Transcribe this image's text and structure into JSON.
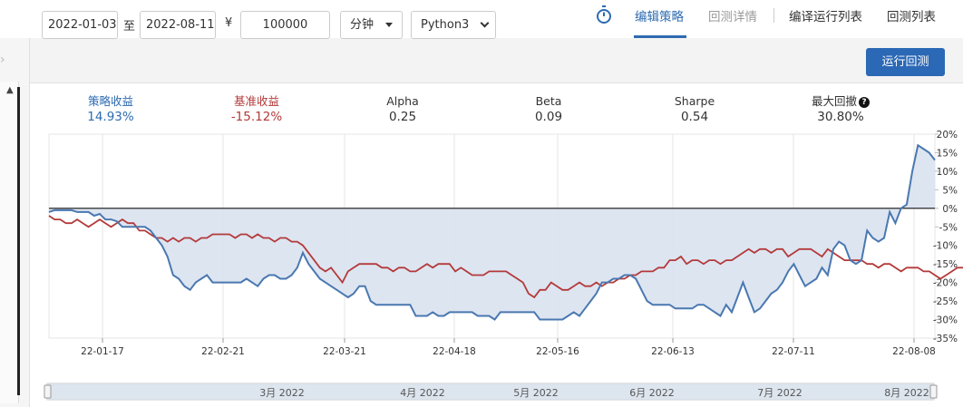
{
  "nav": {
    "items": [
      {
        "label": "编辑策略",
        "active": true
      },
      {
        "label": "回测详情",
        "active": false
      },
      {
        "label": "编译运行列表",
        "active": false
      },
      {
        "label": "回测列表",
        "active": false
      }
    ],
    "timer_icon": "stopwatch-icon"
  },
  "toolbar": {
    "start_date": "2022-01-03",
    "to_label": "至",
    "end_date": "2022-08-11",
    "currency": "¥",
    "capital": "100000",
    "frequency": "分钟",
    "language": "Python3",
    "run_label": "运行回测"
  },
  "metrics": [
    {
      "label": "策略收益",
      "value": "14.93%"
    },
    {
      "label": "基准收益",
      "value": "-15.12%"
    },
    {
      "label": "Alpha",
      "value": "0.25"
    },
    {
      "label": "Beta",
      "value": "0.09"
    },
    {
      "label": "Sharpe",
      "value": "0.54"
    },
    {
      "label": "最大回撤",
      "value": "30.80%"
    }
  ],
  "colors": {
    "accent": "#2e6bb0",
    "strategy": "#4a78b0",
    "benchmark": "#b33a3a",
    "area": "#d9e2ef"
  },
  "chart_data": {
    "type": "line",
    "x_tick_labels": [
      "22-01-17",
      "22-02-21",
      "22-03-21",
      "22-04-18",
      "22-05-16",
      "22-06-13",
      "22-07-11",
      "22-08-08"
    ],
    "y_tick_labels": [
      "20%",
      "15%",
      "10%",
      "5%",
      "0%",
      "-5%",
      "-10%",
      "-15%",
      "-20%",
      "-25%",
      "-30%",
      "-35%"
    ],
    "ylim": [
      -35,
      20
    ],
    "navigator_labels": [
      "3月 2022",
      "4月 2022",
      "5月 2022",
      "6月 2022",
      "7月 2022",
      "8月 2022"
    ],
    "series": [
      {
        "name": "策略收益",
        "values": [
          -1,
          -0.5,
          -0.5,
          -0.5,
          -0.5,
          -1,
          -1,
          -1,
          -2,
          -1.5,
          -3,
          -3,
          -3.5,
          -5,
          -5,
          -5,
          -5,
          -5,
          -6,
          -8,
          -10,
          -13,
          -18,
          -19,
          -21,
          -22,
          -20,
          -19,
          -18,
          -20,
          -20,
          -20,
          -20,
          -20,
          -20,
          -19,
          -20,
          -21,
          -19,
          -18,
          -18,
          -19,
          -19,
          -18,
          -16,
          -12,
          -15,
          -17,
          -19,
          -20,
          -21,
          -22,
          -23,
          -24,
          -23,
          -21,
          -21,
          -25,
          -26,
          -26,
          -26,
          -26,
          -26,
          -26,
          -26,
          -29,
          -29,
          -29,
          -28,
          -29,
          -29,
          -28,
          -28,
          -28,
          -28,
          -28,
          -29,
          -29,
          -29,
          -30,
          -28,
          -28,
          -28,
          -28,
          -28,
          -28,
          -28,
          -30,
          -30,
          -30,
          -30,
          -30,
          -29,
          -28,
          -29,
          -27,
          -25,
          -23,
          -20,
          -20,
          -19,
          -19,
          -18,
          -18,
          -19,
          -22,
          -25,
          -26,
          -26,
          -26,
          -26,
          -27,
          -27,
          -27,
          -27,
          -26,
          -26,
          -27,
          -28,
          -29,
          -26,
          -28,
          -24,
          -20,
          -24,
          -28,
          -27,
          -25,
          -23,
          -22,
          -20,
          -17,
          -15,
          -18,
          -21,
          -20,
          -19,
          -16,
          -18,
          -11,
          -9,
          -10,
          -14,
          -15,
          -14,
          -6,
          -8,
          -9,
          -8,
          -1,
          -4,
          0,
          1,
          10,
          17,
          16,
          15,
          13
        ]
      },
      {
        "name": "基准收益",
        "values": [
          -2,
          -3,
          -3,
          -4,
          -4,
          -3,
          -4,
          -5,
          -4,
          -3,
          -4,
          -5,
          -4,
          -3,
          -4,
          -4,
          -6,
          -6,
          -7,
          -8,
          -8,
          -9,
          -8,
          -9,
          -8,
          -8,
          -9,
          -8,
          -8,
          -7,
          -7,
          -7,
          -7,
          -8,
          -7,
          -7,
          -8,
          -7,
          -8,
          -8,
          -9,
          -8,
          -8,
          -9,
          -9,
          -10,
          -12,
          -14,
          -16,
          -17,
          -16,
          -18,
          -20,
          -17,
          -16,
          -15,
          -15,
          -15,
          -15,
          -16,
          -16,
          -17,
          -16,
          -16,
          -17,
          -17,
          -16,
          -15,
          -16,
          -15,
          -15,
          -15,
          -17,
          -16,
          -17,
          -18,
          -18,
          -18,
          -17,
          -17,
          -17,
          -17,
          -18,
          -19,
          -20,
          -23,
          -24,
          -22,
          -22,
          -20,
          -21,
          -22,
          -22,
          -21,
          -20,
          -21,
          -21,
          -20,
          -21,
          -20,
          -20,
          -19,
          -19,
          -18,
          -18,
          -17,
          -17,
          -17,
          -16,
          -16,
          -14,
          -14,
          -13,
          -15,
          -14,
          -14,
          -15,
          -14,
          -14,
          -15,
          -14,
          -14,
          -13,
          -12,
          -11,
          -12,
          -11,
          -11,
          -12,
          -11,
          -11,
          -13,
          -12,
          -11,
          -11,
          -11,
          -12,
          -13,
          -11,
          -12,
          -13,
          -14,
          -14,
          -14,
          -14,
          -15,
          -15,
          -16,
          -15,
          -15,
          -16,
          -17,
          -16,
          -16,
          -16,
          -17,
          -17,
          -18,
          -19,
          -18,
          -17,
          -16,
          -16,
          -17,
          -17,
          -16
        ]
      }
    ]
  }
}
